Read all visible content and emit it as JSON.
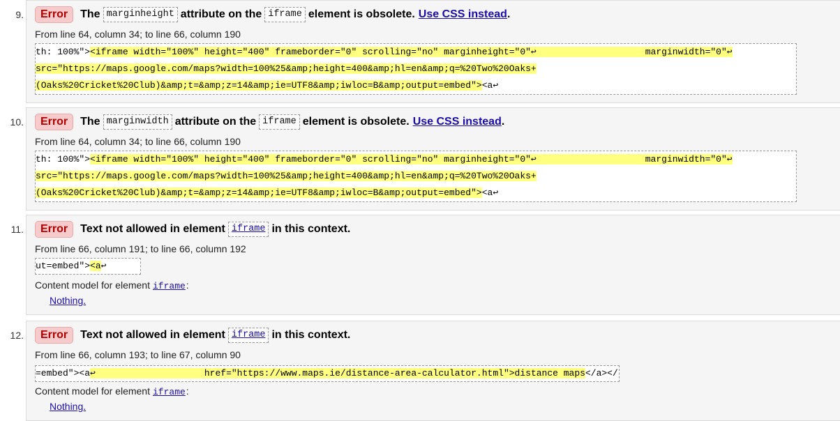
{
  "errors": [
    {
      "number": "9.",
      "badge": "Error",
      "msg_pre": "The",
      "attr": "marginheight",
      "msg_mid": "attribute on the",
      "element": "iframe",
      "msg_post": "element is obsolete.",
      "link_text": "Use CSS instead",
      "period": ".",
      "location": "From line 64, column 34; to line 66, column 190",
      "extract": {
        "l1_plain": "th: 100%\">",
        "l1_hl": "<iframe width=\"100%\" height=\"400\" frameborder=\"0\" scrolling=\"no\" marginheight=\"0\"↩                    marginwidth=\"0\"↩",
        "l2_hl": "src=\"https://maps.google.com/maps?width=100%25&amp;height=400&amp;hl=en&amp;q=%20Two%20Oaks+",
        "l3_hl": "(Oaks%20Cricket%20Club)&amp;t=&amp;z=14&amp;ie=UTF8&amp;iwloc=B&amp;output=embed\">",
        "l3_plain": "<a↩"
      }
    },
    {
      "number": "10.",
      "badge": "Error",
      "msg_pre": "The",
      "attr": "marginwidth",
      "msg_mid": "attribute on the",
      "element": "iframe",
      "msg_post": "element is obsolete.",
      "link_text": "Use CSS instead",
      "period": ".",
      "location": "From line 64, column 34; to line 66, column 190",
      "extract": {
        "l1_plain": "th: 100%\">",
        "l1_hl": "<iframe width=\"100%\" height=\"400\" frameborder=\"0\" scrolling=\"no\" marginheight=\"0\"↩                    marginwidth=\"0\"↩",
        "l2_hl": "src=\"https://maps.google.com/maps?width=100%25&amp;height=400&amp;hl=en&amp;q=%20Two%20Oaks+",
        "l3_hl": "(Oaks%20Cricket%20Club)&amp;t=&amp;z=14&amp;ie=UTF8&amp;iwloc=B&amp;output=embed\">",
        "l3_plain": "<a↩"
      }
    },
    {
      "number": "11.",
      "badge": "Error",
      "msg_pre": "Text not allowed in element",
      "element": "iframe",
      "msg_post": "in this context.",
      "location": "From line 66, column 191; to line 66, column 192",
      "extract": {
        "plain": "ut=embed\">",
        "hl": "<a",
        "tail": "↩"
      },
      "content_model_label": "Content model for element",
      "content_model_element": "iframe",
      "content_model_colon": ":",
      "content_model_value": "Nothing."
    },
    {
      "number": "12.",
      "badge": "Error",
      "msg_pre": "Text not allowed in element",
      "element": "iframe",
      "msg_post": "in this context.",
      "location": "From line 66, column 193; to line 67, column 90",
      "extract": {
        "plain": "=embed\"><a",
        "hl": "↩                    href=\"https://www.maps.ie/distance-area-calculator.html\">distance maps",
        "tail": "</a></"
      },
      "content_model_label": "Content model for element",
      "content_model_element": "iframe",
      "content_model_colon": ":",
      "content_model_value": "Nothing."
    }
  ]
}
